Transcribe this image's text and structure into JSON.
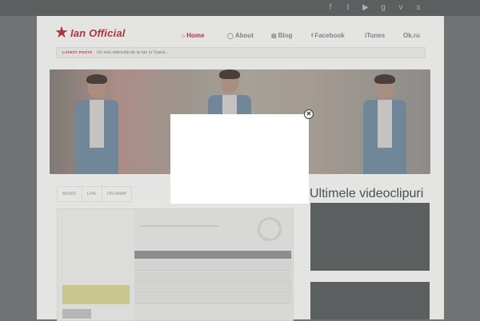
{
  "social": {
    "icons": [
      "facebook-icon",
      "twitter-icon",
      "youtube-icon",
      "google-plus-icon",
      "vk-icon",
      "skype-icon"
    ],
    "glyphs": [
      "f",
      "t",
      "▶",
      "g",
      "v",
      "s"
    ]
  },
  "header": {
    "logo_text": "Ian Official",
    "nav": [
      {
        "label": "Home",
        "icon": "⌂"
      },
      {
        "label": "About",
        "icon": "◯"
      },
      {
        "label": "Blog",
        "icon": "▤"
      },
      {
        "label": "Facebook",
        "icon": "f"
      },
      {
        "label": "iTunes",
        "icon": ""
      },
      {
        "label": "Ok.ru",
        "icon": ""
      }
    ]
  },
  "ticker": {
    "label": "LATEST POSTS",
    "text": "Un nou videoclip de la Ian și Tyana..."
  },
  "tabs": [
    "MUSIC",
    "LIVE",
    "ON SNAP"
  ],
  "sidebar": {
    "title": "Ultimele videoclipuri"
  },
  "modal": {
    "close_glyph": "✕"
  },
  "colors": {
    "accent": "#b0343f",
    "overlay": "#6f7374"
  }
}
